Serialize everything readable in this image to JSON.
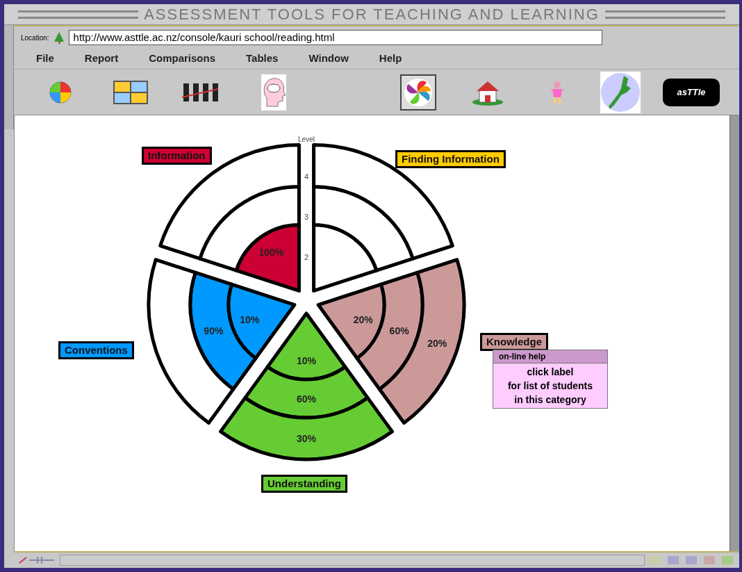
{
  "window": {
    "title": "ASSESSMENT TOOLS FOR TEACHING AND LEARNING"
  },
  "location": {
    "label": "Location:",
    "value": "http://www.asttle.ac.nz/console/kauri school/reading.html"
  },
  "menu": [
    "File",
    "Report",
    "Comparisons",
    "Tables",
    "Window",
    "Help"
  ],
  "toolbar": {
    "logo_text": "asTTle"
  },
  "chart": {
    "axis_title": "Level",
    "levels": [
      "4",
      "3",
      "2"
    ],
    "sectors": [
      {
        "label": "Information",
        "color": "#cc0033",
        "bands": [
          {
            "filled": true,
            "text": "100%"
          },
          {
            "filled": false
          },
          {
            "filled": false
          }
        ]
      },
      {
        "label": "Finding Information",
        "color": "#ffcc00",
        "bands": [
          {
            "filled": false
          },
          {
            "filled": false
          },
          {
            "filled": false
          }
        ]
      },
      {
        "label": "Knowledge",
        "color": "#cc9999",
        "bands": [
          {
            "filled": true,
            "text": "20%"
          },
          {
            "filled": true,
            "text": "60%"
          },
          {
            "filled": true,
            "text": "20%"
          }
        ]
      },
      {
        "label": "Understanding",
        "color": "#66cc33",
        "bands": [
          {
            "filled": true,
            "text": "10%"
          },
          {
            "filled": true,
            "text": "60%"
          },
          {
            "filled": true,
            "text": "30%"
          }
        ]
      },
      {
        "label": "Conventions",
        "color": "#0099ff",
        "bands": [
          {
            "filled": true,
            "text": "10%"
          },
          {
            "filled": true,
            "text": "90%"
          },
          {
            "filled": false
          }
        ]
      }
    ]
  },
  "help_popup": {
    "title": "on-line help",
    "text": "click label\nfor list of students\nin this category"
  }
}
